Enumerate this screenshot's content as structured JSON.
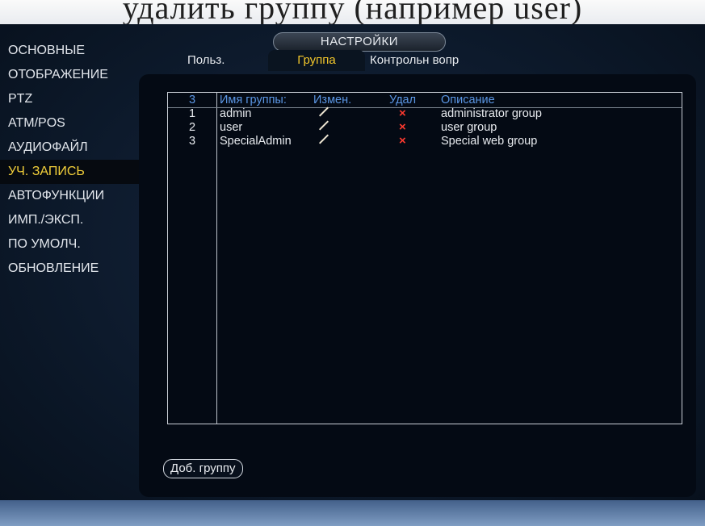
{
  "caption_text": "удалить группу (например user)",
  "window_title": "НАСТРОЙКИ",
  "sidebar": {
    "items": [
      {
        "label": "ОСНОВНЫЕ",
        "active": false
      },
      {
        "label": "ОТОБРАЖЕНИЕ",
        "active": false
      },
      {
        "label": "PTZ",
        "active": false
      },
      {
        "label": "ATM/POS",
        "active": false
      },
      {
        "label": "АУДИОФАЙЛ",
        "active": false
      },
      {
        "label": "УЧ. ЗАПИСЬ",
        "active": true
      },
      {
        "label": "АВТОФУНКЦИИ",
        "active": false
      },
      {
        "label": "ИМП./ЭКСП.",
        "active": false
      },
      {
        "label": "ПО УМОЛЧ.",
        "active": false
      },
      {
        "label": "ОБНОВЛЕНИЕ",
        "active": false
      }
    ]
  },
  "tabs": {
    "user": "Польз.",
    "group": "Группа",
    "security": "Контрольн вопр"
  },
  "table": {
    "headers": {
      "count": "3",
      "name": "Имя группы:",
      "edit": "Измен.",
      "delete": "Удал",
      "description": "Описание"
    },
    "rows": [
      {
        "num": "1",
        "name": "admin",
        "description": "administrator group"
      },
      {
        "num": "2",
        "name": "user",
        "description": "user group"
      },
      {
        "num": "3",
        "name": "SpecialAdmin",
        "description": "Special web group"
      }
    ],
    "delete_glyph": "×"
  },
  "add_group_button": "Доб. группу",
  "colors": {
    "accent": "#f3c72b",
    "header_text": "#5b96e4",
    "delete_icon": "#ff3a2f"
  }
}
